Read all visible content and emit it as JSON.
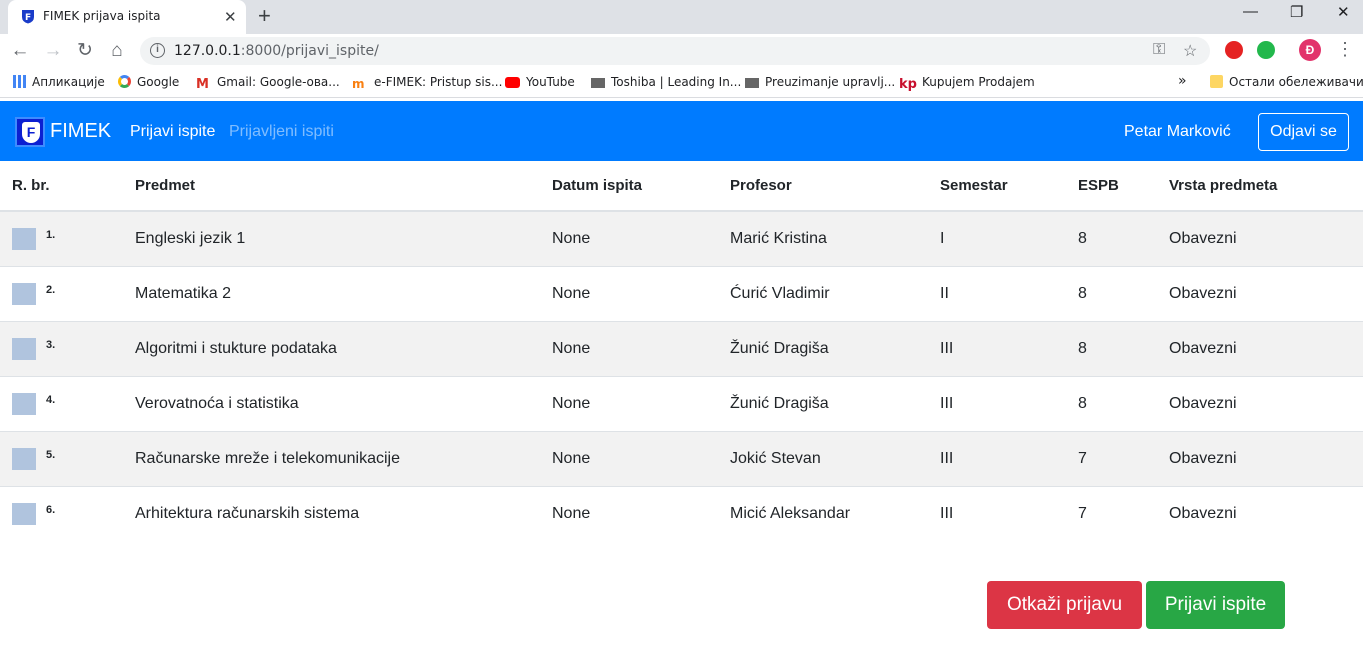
{
  "browser": {
    "tab_title": "FIMEK prijava ispita",
    "url_host": "127.0.0.1",
    "url_path": ":8000/prijavi_ispite/",
    "profile_initial": "Đ",
    "bookmarks": [
      {
        "label": "Апликације",
        "icon": "apps-icon"
      },
      {
        "label": "Google",
        "icon": "google-icon"
      },
      {
        "label": "Gmail: Google-ова...",
        "icon": "gmail-icon"
      },
      {
        "label": "e-FIMEK: Pristup sis...",
        "icon": "moodle-icon"
      },
      {
        "label": "YouTube",
        "icon": "youtube-icon"
      },
      {
        "label": "Toshiba | Leading In...",
        "icon": "toshiba-icon"
      },
      {
        "label": "Preuzimanje upravlj...",
        "icon": "toshiba-icon"
      },
      {
        "label": "Kupujem Prodajem",
        "icon": "kp-icon"
      }
    ],
    "more_bookmarks": "»",
    "other_bookmarks": "Остали обележивачи"
  },
  "navbar": {
    "brand": "FIMEK",
    "logo_letter": "F",
    "links": [
      {
        "label": "Prijavi ispite",
        "active": true
      },
      {
        "label": "Prijavljeni ispiti",
        "active": false
      }
    ],
    "user": "Petar Marković",
    "logout": "Odjavi se"
  },
  "table": {
    "headers": [
      "R. br.",
      "Predmet",
      "Datum ispita",
      "Profesor",
      "Semestar",
      "ESPB",
      "Vrsta predmeta"
    ],
    "rows": [
      {
        "rb": "1.",
        "predmet": "Engleski jezik 1",
        "datum": "None",
        "profesor": "Marić Kristina",
        "semestar": "I",
        "espb": "8",
        "vrsta": "Obavezni"
      },
      {
        "rb": "2.",
        "predmet": "Matematika 2",
        "datum": "None",
        "profesor": "Ćurić Vladimir",
        "semestar": "II",
        "espb": "8",
        "vrsta": "Obavezni"
      },
      {
        "rb": "3.",
        "predmet": "Algoritmi i stukture podataka",
        "datum": "None",
        "profesor": "Žunić Dragiša",
        "semestar": "III",
        "espb": "8",
        "vrsta": "Obavezni"
      },
      {
        "rb": "4.",
        "predmet": "Verovatnoća i statistika",
        "datum": "None",
        "profesor": "Žunić Dragiša",
        "semestar": "III",
        "espb": "8",
        "vrsta": "Obavezni"
      },
      {
        "rb": "5.",
        "predmet": "Računarske mreže i telekomunikacije",
        "datum": "None",
        "profesor": "Jokić Stevan",
        "semestar": "III",
        "espb": "7",
        "vrsta": "Obavezni"
      },
      {
        "rb": "6.",
        "predmet": "Arhitektura računarskih sistema",
        "datum": "None",
        "profesor": "Micić Aleksandar",
        "semestar": "III",
        "espb": "7",
        "vrsta": "Obavezni"
      }
    ]
  },
  "actions": {
    "cancel": "Otkaži prijavu",
    "submit": "Prijavi ispite"
  },
  "colors": {
    "primary": "#007bff",
    "danger": "#dc3545",
    "success": "#28a745"
  }
}
